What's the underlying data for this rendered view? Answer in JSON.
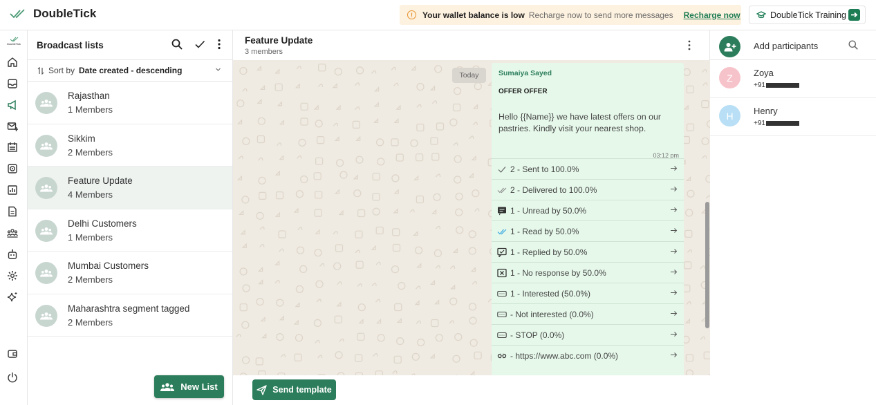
{
  "app": {
    "brand": "DoubleTick",
    "rail_logo_text": "DoubleTick"
  },
  "wallet_banner": {
    "title": "Your wallet balance is low",
    "message": "Recharge now to send more messages",
    "link": "Recharge now"
  },
  "training_button": {
    "label": "DoubleTick Training"
  },
  "broadcast": {
    "title": "Broadcast lists",
    "sort_prefix": "Sort by",
    "sort_value": "Date created - descending",
    "items": [
      {
        "name": "Rajasthan",
        "members": "1 Members"
      },
      {
        "name": "Sikkim",
        "members": "2 Members"
      },
      {
        "name": "Feature Update",
        "members": "4 Members",
        "active": true
      },
      {
        "name": "Delhi Customers",
        "members": "1 Members"
      },
      {
        "name": "Mumbai Customers",
        "members": "2 Members"
      },
      {
        "name": "Maharashtra segment tagged",
        "members": "2 Members"
      }
    ],
    "new_list_label": "New List"
  },
  "chat": {
    "title": "Feature Update",
    "subtitle": "3 members",
    "date_chip": "Today",
    "message": {
      "sender": "Sumaiya Sayed",
      "header": "OFFER OFFER",
      "body": "Hello {{Name}} we have latest offers on our pastries. Kindly visit your nearest shop.",
      "time": "03:12 pm",
      "stats": [
        {
          "icon": "check-icon",
          "label": "2 - Sent to 100.0%"
        },
        {
          "icon": "double-check-icon",
          "label": "2 - Delivered to 100.0%"
        },
        {
          "icon": "unread-icon",
          "label": "1 - Unread by 50.0%"
        },
        {
          "icon": "read-icon",
          "label": "1 - Read by 50.0%"
        },
        {
          "icon": "reply-icon",
          "label": "1 - Replied by 50.0%"
        },
        {
          "icon": "no-response-icon",
          "label": "1 - No response by 50.0%"
        },
        {
          "icon": "button-icon",
          "label": "1 - Interested (50.0%)"
        },
        {
          "icon": "button-icon",
          "label": " - Not interested (0.0%)"
        },
        {
          "icon": "button-icon",
          "label": " - STOP (0.0%)"
        },
        {
          "icon": "link-icon",
          "label": " - https://www.abc.com (0.0%)"
        }
      ]
    },
    "send_template_label": "Send template"
  },
  "participants": {
    "title": "Add participants",
    "items": [
      {
        "initial": "Z",
        "name": "Zoya",
        "phone_prefix": "+91",
        "color": "#f7c3ca"
      },
      {
        "initial": "H",
        "name": "Henry",
        "phone_prefix": "+91",
        "color": "#b8dff5"
      }
    ]
  },
  "colors": {
    "accent": "#2b7d5b",
    "chat_bg": "#efeae2",
    "bubble": "#e6f8ea",
    "active_row": "#eef3f0"
  }
}
